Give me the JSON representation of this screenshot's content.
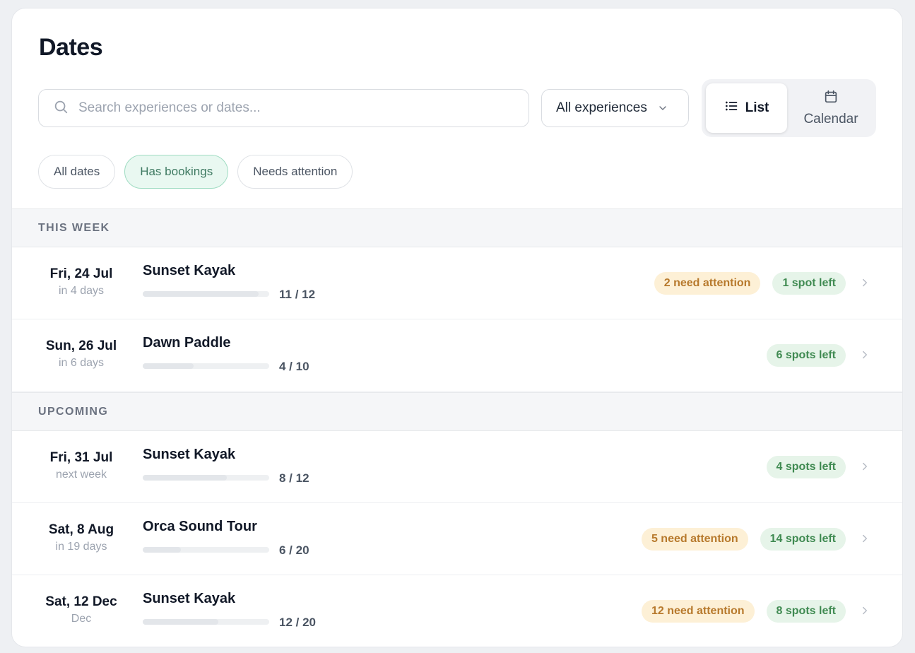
{
  "page_title": "Dates",
  "search": {
    "placeholder": "Search experiences or dates...",
    "value": "",
    "icon": "search-icon"
  },
  "filter_select": {
    "selected": "All experiences",
    "icon": "chevron-down-icon"
  },
  "view_toggle": {
    "list_label": "List",
    "calendar_label": "Calendar",
    "active": "List"
  },
  "chips": [
    {
      "label": "All dates",
      "active": false
    },
    {
      "label": "Has bookings",
      "active": true
    },
    {
      "label": "Needs attention",
      "active": false
    }
  ],
  "sections": [
    {
      "title": "THIS WEEK",
      "rows": [
        {
          "date": "Fri, 24 Jul",
          "relative": "in 4 days",
          "experience": "Sunset Kayak",
          "booked": 11,
          "capacity": 12,
          "count_label": "11 / 12",
          "attention": "2 need attention",
          "spots": "1 spot left"
        },
        {
          "date": "Sun, 26 Jul",
          "relative": "in 6 days",
          "experience": "Dawn Paddle",
          "booked": 4,
          "capacity": 10,
          "count_label": "4 / 10",
          "attention": "",
          "spots": "6 spots left"
        }
      ]
    },
    {
      "title": "UPCOMING",
      "rows": [
        {
          "date": "Fri, 31 Jul",
          "relative": "next week",
          "experience": "Sunset Kayak",
          "booked": 8,
          "capacity": 12,
          "count_label": "8 / 12",
          "attention": "",
          "spots": "4 spots left"
        },
        {
          "date": "Sat, 8 Aug",
          "relative": "in 19 days",
          "experience": "Orca Sound Tour",
          "booked": 6,
          "capacity": 20,
          "count_label": "6 / 20",
          "attention": "5 need attention",
          "spots": "14 spots left"
        },
        {
          "date": "Sat, 12 Dec",
          "relative": "Dec",
          "experience": "Sunset Kayak",
          "booked": 12,
          "capacity": 20,
          "count_label": "12 / 20",
          "attention": "12 need attention",
          "spots": "8 spots left"
        }
      ]
    }
  ],
  "colors": {
    "chip_active_bg": "#e9f8f1",
    "attention_bg": "#fdf0d6",
    "attention_text": "#b7792c",
    "spots_bg": "#e6f4e9",
    "spots_text": "#3f8a51"
  }
}
